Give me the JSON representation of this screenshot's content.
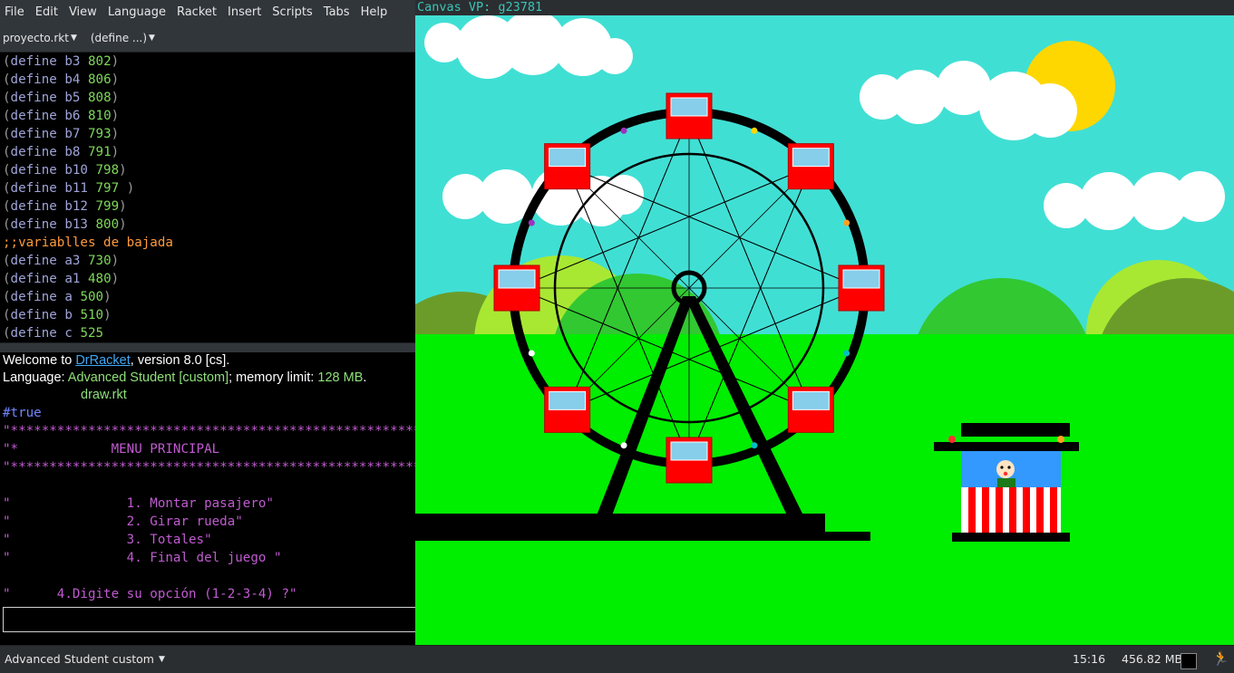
{
  "menubar": {
    "items": [
      "File",
      "Edit",
      "View",
      "Language",
      "Racket",
      "Insert",
      "Scripts",
      "Tabs",
      "Help"
    ]
  },
  "toolbar": {
    "file_menu": "proyecto.rkt",
    "define_menu": "(define ...)"
  },
  "editor": {
    "lines": [
      {
        "kw": "define",
        "name": "b3",
        "value": "802"
      },
      {
        "kw": "define",
        "name": "b4",
        "value": "806"
      },
      {
        "kw": "define",
        "name": "b5",
        "value": "808"
      },
      {
        "kw": "define",
        "name": "b6",
        "value": "810"
      },
      {
        "kw": "define",
        "name": "b7",
        "value": "793"
      },
      {
        "kw": "define",
        "name": "b8",
        "value": "791"
      },
      {
        "kw": "define",
        "name": "b10",
        "value": "798"
      },
      {
        "kw": "define",
        "name": "b11",
        "value": "797 "
      },
      {
        "kw": "define",
        "name": "b12",
        "value": "799"
      },
      {
        "kw": "define",
        "name": "b13",
        "value": "800"
      },
      {
        "comment": ";;variablles de bajada"
      },
      {
        "kw": "define",
        "name": "a3",
        "value": "730"
      },
      {
        "kw": "define",
        "name": "a1",
        "value": "480"
      },
      {
        "kw": "define",
        "name": "a",
        "value": "500"
      },
      {
        "kw": "define",
        "name": "b",
        "value": "510"
      },
      {
        "kw": "define",
        "name": "c",
        "value": "525"
      }
    ]
  },
  "repl": {
    "welcome_prefix": "Welcome to ",
    "welcome_link": "DrRacket",
    "welcome_suffix": ", version 8.0 [cs].",
    "language_prefix": "Language: ",
    "language_name": "Advanced Student [custom]",
    "language_mid": "; memory limit: ",
    "memory_limit": "128 MB",
    "language_suffix": ".",
    "teachpack": "draw.rkt",
    "result": "#true",
    "menu_lines": [
      "\"*****************************************************",
      "\"*            MENU PRINCIPAL",
      "\"*****************************************************",
      "",
      "\"               1. Montar pasajero\"",
      "\"               2. Girar rueda\"",
      "\"               3. Totales\"",
      "\"               4. Final del juego \"",
      "",
      "\"      4.Digite su opción (1-2-3-4) ?\""
    ]
  },
  "statusbar": {
    "language": "Advanced Student custom",
    "time": "15:16",
    "memory": "456.82 MB"
  },
  "canvas": {
    "title": "Canvas VP: g23781",
    "colors": {
      "sky": "#40dfd4",
      "grass": "#00ee00",
      "sun": "#ffd700",
      "gondola": "#ff0000",
      "window": "#87ceeb",
      "hill_dark": "#6b9c2a",
      "hill_mid": "#32c832",
      "hill_light": "#a8e832",
      "booth": "#3399ff"
    }
  }
}
